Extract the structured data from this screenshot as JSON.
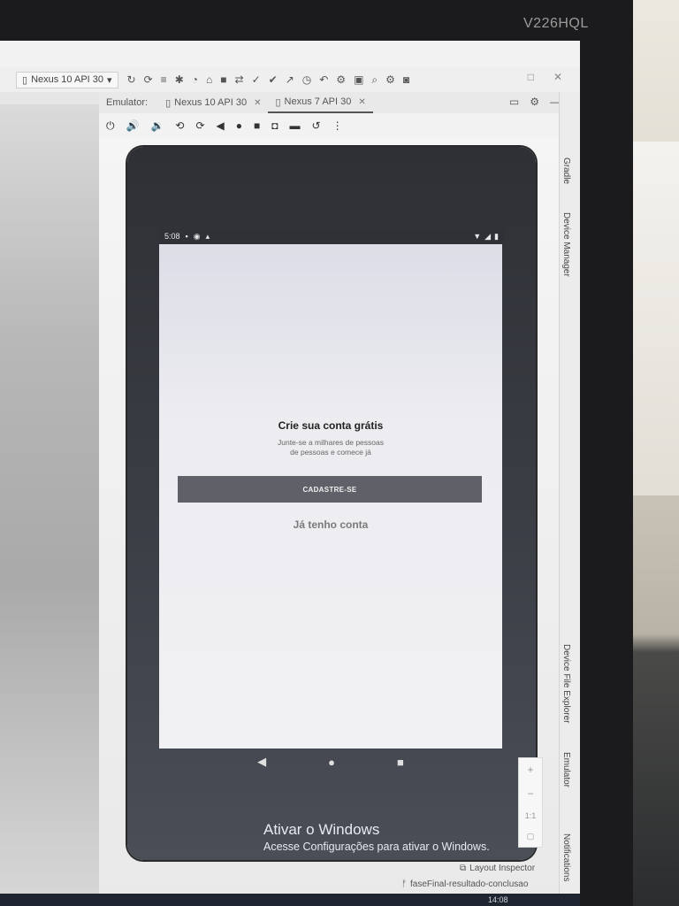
{
  "monitor": {
    "brand": "V226HQL"
  },
  "toolbar": {
    "device_selector": "Nexus 10 API 30"
  },
  "emulator_panel": {
    "label": "Emulator:",
    "tabs": [
      {
        "label": "Nexus 10 API 30",
        "active": false
      },
      {
        "label": "Nexus 7 API 30",
        "active": true
      }
    ]
  },
  "right_tools": {
    "gradle": "Gradle",
    "device_manager": "Device Manager",
    "device_file_explorer": "Device File Explorer",
    "emulator": "Emulator",
    "notifications": "Notifications"
  },
  "status_bar": {
    "time": "5:08"
  },
  "app": {
    "title": "Crie sua conta grátis",
    "subtitle_line1": "Junte-se a milhares de pessoas",
    "subtitle_line2": "de pessoas e comece já",
    "signup_button": "CADASTRE-SE",
    "login_link": "Já tenho conta"
  },
  "zoom": {
    "plus": "+",
    "minus": "−",
    "ratio": "1:1"
  },
  "watermark": {
    "title": "Ativar o Windows",
    "subtitle": "Acesse Configurações para ativar o Windows."
  },
  "bottom": {
    "layout_inspector": "Layout Inspector",
    "branch": "faseFinal-resultado-conclusao",
    "clock": "14:08"
  },
  "colors": {
    "button_bg": "#606168",
    "device_frame": "#3a3d44",
    "app_background": "#ececf1"
  }
}
